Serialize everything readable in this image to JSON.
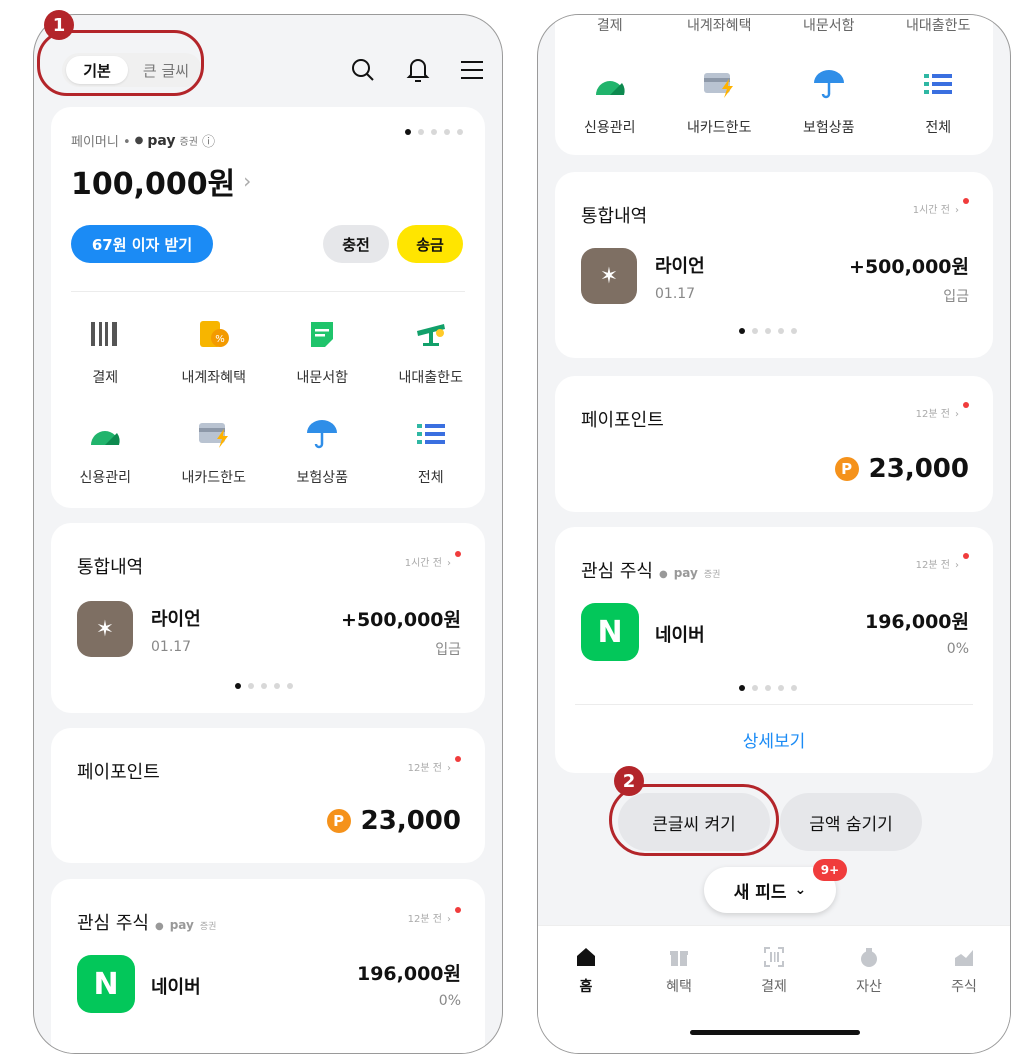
{
  "step_badges": [
    "1",
    "2"
  ],
  "left": {
    "toggle": {
      "basic": "기본",
      "large": "큰 글씨"
    },
    "balance": {
      "label": "페이머니 •",
      "pay": "pay",
      "securities": "증권",
      "info_icon": "ⓘ",
      "amount": "100,000원",
      "interest_btn": "67원 이자 받기",
      "charge_btn": "충전",
      "send_btn": "송금"
    },
    "menu_row1": [
      "결제",
      "내계좌혜택",
      "내문서함",
      "내대출한도"
    ],
    "menu_row2": [
      "신용관리",
      "내카드한도",
      "보험상품",
      "전체"
    ]
  },
  "history": {
    "title": "통합내역",
    "time": "1시간 전",
    "name": "라이언",
    "date": "01.17",
    "amount": "+500,000원",
    "type": "입금"
  },
  "points": {
    "title": "페이포인트",
    "time": "12분 전",
    "p_symbol": "P",
    "amount": "23,000"
  },
  "stock": {
    "title": "관심 주식",
    "pay": "pay",
    "securities": "증권",
    "time": "12분 전",
    "name": "네이버",
    "logo_letter": "N",
    "price": "196,000원",
    "change": "0%",
    "detail": "상세보기"
  },
  "right": {
    "top_cut_labels": [
      "결제",
      "내계좌혜택",
      "내문서함",
      "내대출한도"
    ],
    "menu_row2": [
      "신용관리",
      "내카드한도",
      "보험상품",
      "전체"
    ],
    "big_text_btn": "큰글씨 켜기",
    "hide_amount_btn": "금액 숨기기",
    "new_feed": "새 피드",
    "feed_badge": "9+",
    "tabs": [
      "홈",
      "혜택",
      "결제",
      "자산",
      "주식"
    ]
  },
  "colors": {
    "accent_blue": "#1b8bf5",
    "yellow": "#ffe500",
    "highlight": "#b3252a",
    "naver": "#03c75a"
  }
}
